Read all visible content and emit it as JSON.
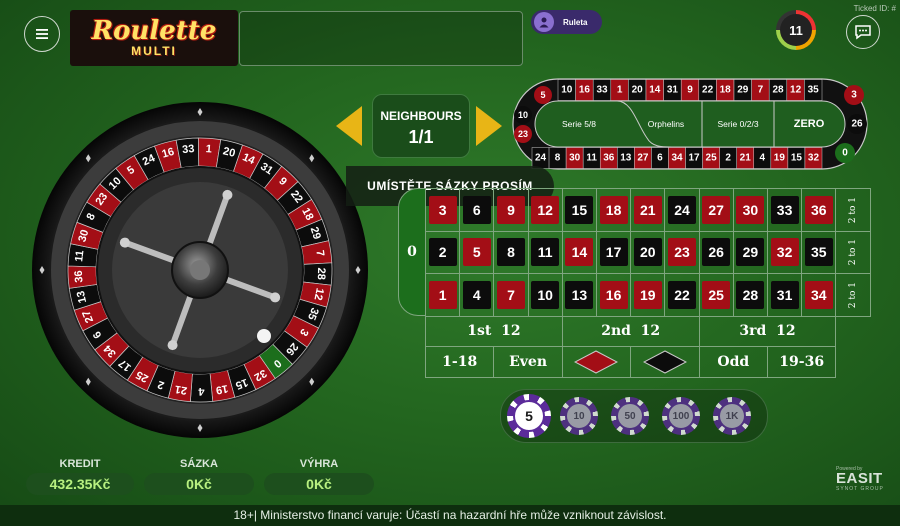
{
  "header": {
    "menu_icon": "hamburger-icon",
    "logo_main": "Roulette",
    "logo_sub": "MULTI",
    "user_name": "Ruleta",
    "ticked_id": "Ticked ID: #",
    "timer_value": "11",
    "chat_icon": "chat-bubble-icon"
  },
  "neighbours": {
    "title": "NEIGHBOURS",
    "value": "1/1"
  },
  "racetrack": {
    "top_row": [
      "5",
      "10",
      "23",
      "8",
      "30",
      "11",
      "36",
      "13",
      "27",
      "6",
      "34",
      "17",
      "25",
      "2",
      "21",
      "4",
      "19",
      "15",
      "32"
    ],
    "top_row_display": [
      "10",
      "16",
      "33",
      "1",
      "20",
      "14",
      "31",
      "9",
      "22",
      "18",
      "29",
      "7",
      "28",
      "12",
      "35"
    ],
    "bottom_row": [
      "24",
      "8",
      "30",
      "11",
      "36",
      "13",
      "27",
      "6",
      "34",
      "17",
      "25",
      "2",
      "21",
      "4",
      "19",
      "15",
      "32"
    ],
    "left_end": [
      "5",
      "24",
      "16"
    ],
    "right_end": [
      "3",
      "26",
      "0"
    ],
    "sections": [
      "Serie 5/8",
      "Orphelins",
      "Serie 0/2/3",
      "ZERO"
    ]
  },
  "banner": "UMÍSTĚTE SÁZKY PROSÍM",
  "table": {
    "zero": "0",
    "rows": [
      [
        "3",
        "6",
        "9",
        "12",
        "15",
        "18",
        "21",
        "24",
        "27",
        "30",
        "33",
        "36"
      ],
      [
        "2",
        "5",
        "8",
        "11",
        "14",
        "17",
        "20",
        "23",
        "26",
        "29",
        "32",
        "35"
      ],
      [
        "1",
        "4",
        "7",
        "10",
        "13",
        "16",
        "19",
        "22",
        "25",
        "28",
        "31",
        "34"
      ]
    ],
    "red_numbers": [
      "1",
      "3",
      "5",
      "7",
      "9",
      "12",
      "14",
      "16",
      "18",
      "19",
      "21",
      "23",
      "25",
      "27",
      "30",
      "32",
      "34",
      "36"
    ],
    "column_bet": "2 to 1",
    "dozens": [
      "1st  12",
      "2nd  12",
      "3rd  12"
    ],
    "outside": [
      "1-18",
      "Even",
      "",
      "",
      "Odd",
      "19-36"
    ]
  },
  "chips": [
    {
      "value": "5",
      "selected": true
    },
    {
      "value": "10",
      "selected": false
    },
    {
      "value": "50",
      "selected": false
    },
    {
      "value": "100",
      "selected": false
    },
    {
      "value": "1K",
      "selected": false
    }
  ],
  "stats": {
    "credit_label": "KREDIT",
    "credit_value": "432.35Kč",
    "bet_label": "SÁZKA",
    "bet_value": "0Kč",
    "win_label": "VÝHRA",
    "win_value": "0Kč"
  },
  "branding": {
    "powered": "Powered by",
    "name": "EASIT",
    "sub": "SYNOT GROUP"
  },
  "footer": "18+| Ministerstvo financí varuje: Účastí na hazardní hře může vzniknout závislost.",
  "wheel": {
    "numbers": [
      "0",
      "32",
      "15",
      "19",
      "4",
      "21",
      "2",
      "25",
      "17",
      "34",
      "6",
      "27",
      "13",
      "36",
      "11",
      "30",
      "8",
      "23",
      "10",
      "5",
      "24",
      "16",
      "33",
      "1",
      "20",
      "14",
      "31",
      "9",
      "22",
      "18",
      "29",
      "7",
      "28",
      "12",
      "35",
      "3",
      "26"
    ]
  },
  "colors": {
    "red": "#a30e16",
    "black": "#0c0c0c",
    "green": "#1c6e1c",
    "felt": "#23661f",
    "gold": "#e8b516",
    "chip": "#5b2b9a"
  }
}
